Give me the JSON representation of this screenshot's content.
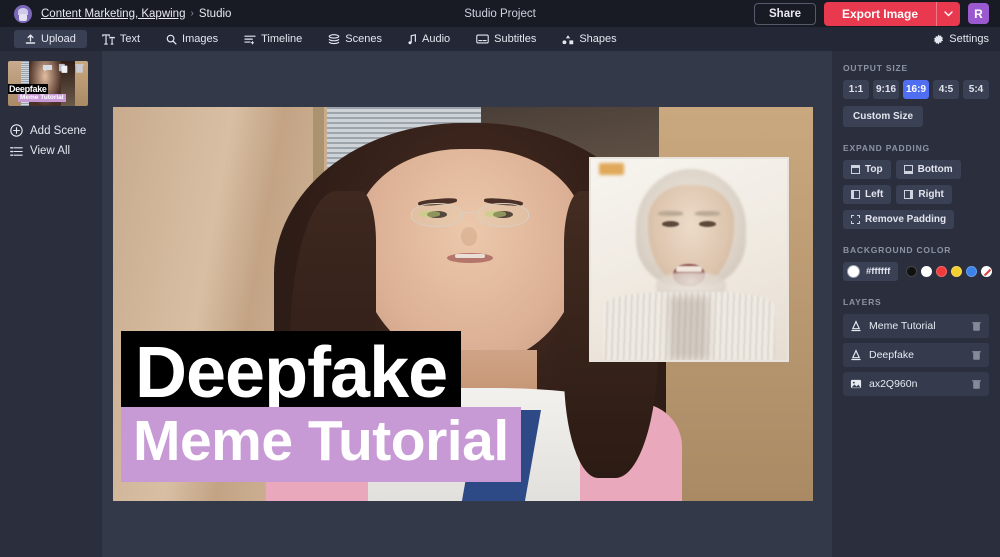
{
  "topbar": {
    "breadcrumb_link": "Content Marketing, Kapwing",
    "breadcrumb_sep": "›",
    "breadcrumb_current": "Studio",
    "project_title": "Studio Project",
    "share_label": "Share",
    "export_label": "Export Image",
    "export_caret": "⌄",
    "user_initial": "R",
    "brand_red": "#e8394f",
    "avatar_purple": "#9b59d0"
  },
  "toolbar": {
    "items": [
      {
        "label": "Upload",
        "icon": "upload-icon",
        "active": true
      },
      {
        "label": "Text",
        "icon": "text-icon",
        "active": false
      },
      {
        "label": "Images",
        "icon": "search-icon",
        "active": false
      },
      {
        "label": "Timeline",
        "icon": "timeline-icon",
        "active": false
      },
      {
        "label": "Scenes",
        "icon": "scenes-icon",
        "active": false
      },
      {
        "label": "Audio",
        "icon": "audio-note-icon",
        "active": false
      },
      {
        "label": "Subtitles",
        "icon": "subtitles-icon",
        "active": false
      },
      {
        "label": "Shapes",
        "icon": "shapes-icon",
        "active": false
      }
    ],
    "settings_label": "Settings"
  },
  "left_panel": {
    "scene_thumb_text_top": "Deepfake",
    "scene_thumb_text_bottom": "Meme Tutorial",
    "thumb_icons": [
      "comment-icon",
      "duplicate-icon",
      "trash-icon"
    ],
    "add_scene_label": "Add Scene",
    "view_all_label": "View All"
  },
  "canvas": {
    "overlay_top_text": "Deepfake",
    "overlay_top_bg": "#000000",
    "overlay_bottom_text": "Meme Tutorial",
    "overlay_bottom_bg": "#c79ad6",
    "overlay_text_color": "#ffffff"
  },
  "right_panel": {
    "output_size_label": "OUTPUT SIZE",
    "ratios": [
      "1:1",
      "9:16",
      "16:9",
      "4:5",
      "5:4"
    ],
    "ratio_selected": "16:9",
    "ratio_selected_color": "#4f6ef2",
    "custom_size_label": "Custom Size",
    "expand_padding_label": "EXPAND PADDING",
    "padding_buttons": [
      "Top",
      "Bottom",
      "Left",
      "Right",
      "Remove Padding"
    ],
    "background_color_label": "BACKGROUND COLOR",
    "background_hex": "#ffffff",
    "swatches": [
      "#111111",
      "#ffffff",
      "#ef3b3b",
      "#f5cf2e",
      "#3b82e8",
      "none"
    ],
    "layers_label": "LAYERS",
    "layers": [
      {
        "name": "Meme Tutorial",
        "icon": "text-layer-icon"
      },
      {
        "name": "Deepfake",
        "icon": "text-layer-icon"
      },
      {
        "name": "ax2Q960n",
        "icon": "image-layer-icon"
      }
    ]
  }
}
